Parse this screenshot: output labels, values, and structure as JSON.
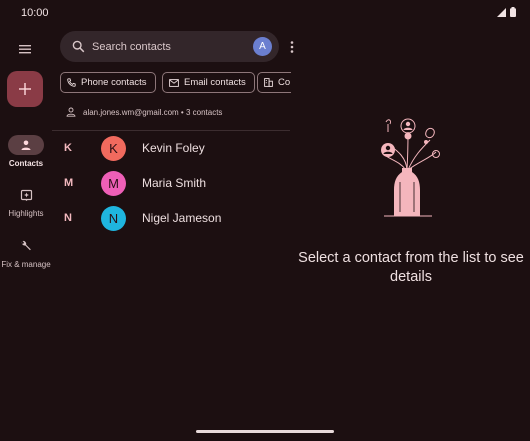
{
  "status_bar": {
    "time": "10:00"
  },
  "nav_rail": {
    "items": [
      {
        "label": "Contacts",
        "icon": "person-icon",
        "active": true
      },
      {
        "label": "Highlights",
        "icon": "highlights-icon",
        "active": false
      },
      {
        "label": "Fix & manage",
        "icon": "wrench-icon",
        "active": false
      }
    ]
  },
  "search": {
    "placeholder": "Search contacts",
    "avatar_letter": "A"
  },
  "chips": [
    {
      "label": "Phone contacts",
      "icon": "phone-icon"
    },
    {
      "label": "Email contacts",
      "icon": "email-icon"
    },
    {
      "label": "Co",
      "icon": "building-icon"
    }
  ],
  "account": {
    "text": "alan.jones.wm@gmail.com • 3 contacts"
  },
  "contacts": [
    {
      "section": "K",
      "initial": "K",
      "name": "Kevin Foley",
      "color": "#f16a5e"
    },
    {
      "section": "M",
      "initial": "M",
      "name": "Maria Smith",
      "color": "#ee5fb7"
    },
    {
      "section": "N",
      "initial": "N",
      "name": "Nigel Jameson",
      "color": "#1fb5df"
    }
  ],
  "detail": {
    "message": "Select a contact from the list to see details"
  },
  "colors": {
    "background": "#1c0f11",
    "fab": "#8a3b46",
    "accent_letter": "#f3b9bf"
  }
}
